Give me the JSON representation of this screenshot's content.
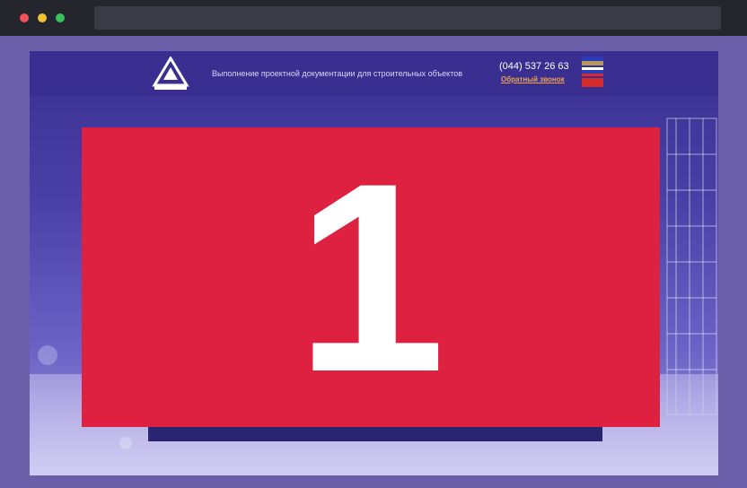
{
  "header": {
    "tagline": "Выполнение проектной документации для строительных объектов",
    "phone": "(044) 537 26 63",
    "callback_label": "Обратный звонок",
    "languages": [
      "UA",
      "RU",
      "EN"
    ]
  },
  "overlay": {
    "number": "1",
    "color": "#de2140"
  },
  "colors": {
    "site_bg": "#3a2f91",
    "accent": "#f2a547"
  }
}
